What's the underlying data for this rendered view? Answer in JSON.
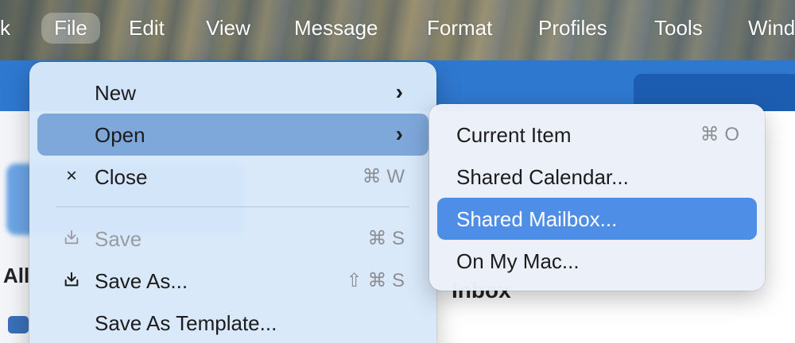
{
  "menubar": {
    "items": [
      "k",
      "File",
      "Edit",
      "View",
      "Message",
      "Format",
      "Profiles",
      "Tools",
      "Wind"
    ]
  },
  "background": {
    "list_heading": "All",
    "inbox_label": "Inbox"
  },
  "file_menu": {
    "items": [
      {
        "label": "New",
        "shortcut": "",
        "icon": "",
        "submenu": true
      },
      {
        "label": "Open",
        "shortcut": "",
        "icon": "",
        "submenu": true
      },
      {
        "label": "Close",
        "shortcut": "⌘ W",
        "icon": "×"
      },
      {
        "label": "Save",
        "shortcut": "⌘ S",
        "icon": "save-icon"
      },
      {
        "label": "Save As...",
        "shortcut": "⇧ ⌘ S",
        "icon": "save-as-icon"
      },
      {
        "label": "Save As Template...",
        "shortcut": "",
        "icon": ""
      }
    ],
    "chevron": "›"
  },
  "open_submenu": {
    "items": [
      {
        "label": "Current Item",
        "shortcut": "⌘ O"
      },
      {
        "label": "Shared Calendar...",
        "shortcut": ""
      },
      {
        "label": "Shared Mailbox...",
        "shortcut": ""
      },
      {
        "label": "On My Mac...",
        "shortcut": ""
      }
    ]
  },
  "colors": {
    "app_blue": "#2f78d0",
    "menu_highlight": "#7ea8da",
    "submenu_highlight": "#4f8ee6"
  }
}
